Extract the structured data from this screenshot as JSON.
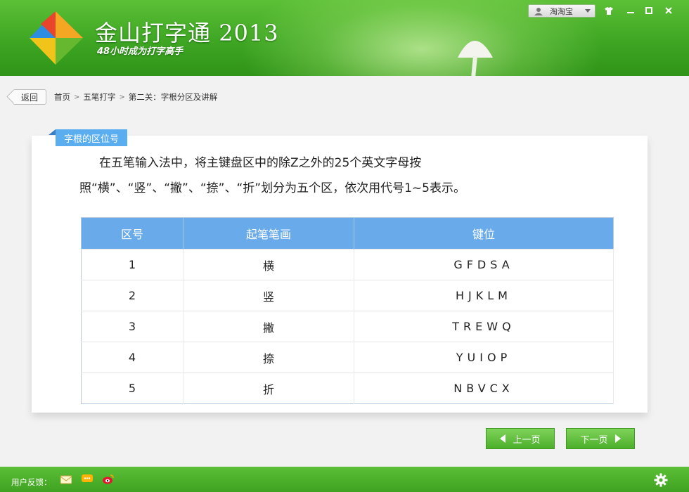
{
  "app": {
    "title": "金山打字通",
    "year": "2013",
    "slogan": "48小时成为打字高手"
  },
  "account": {
    "label": "淘淘宝"
  },
  "window_controls": [
    "shirt-icon",
    "minimize-icon",
    "maximize-icon",
    "close-icon"
  ],
  "breadcrumb": {
    "back_label": "返回",
    "items": [
      "首页",
      "五笔打字",
      "第二关：字根分区及讲解"
    ],
    "separator": ">"
  },
  "lesson": {
    "tag": "字根的区位号",
    "paragraph": "在五笔输入法中，将主键盘区中的除Z之外的25个英文字母按照“横”、“竖”、“撇”、“捺”、“折”划分为五个区，依次用代号1~5表示。",
    "table": {
      "headers": [
        "区号",
        "起笔笔画",
        "键位"
      ],
      "rows": [
        [
          "1",
          "横",
          "GFDSA"
        ],
        [
          "2",
          "竖",
          "HJKLM"
        ],
        [
          "3",
          "撇",
          "TREWQ"
        ],
        [
          "4",
          "捺",
          "YUIOP"
        ],
        [
          "5",
          "折",
          "NBVCX"
        ]
      ]
    }
  },
  "nav": {
    "prev_label": "上一页",
    "next_label": "下一页"
  },
  "footer": {
    "feedback_label": "用户反馈：",
    "icons": [
      "mail-icon",
      "chat-icon",
      "weibo-icon"
    ],
    "settings_icon": "gear-icon"
  },
  "colors": {
    "header_green": "#3ea623",
    "table_header_blue": "#69aaea",
    "tag_blue": "#5aaeef",
    "button_green": "#4caf2a"
  }
}
